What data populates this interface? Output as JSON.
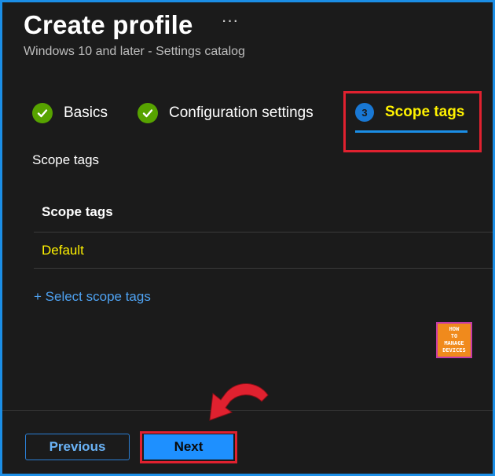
{
  "header": {
    "title": "Create profile",
    "more_icon": "···",
    "subtitle": "Windows 10 and later - Settings catalog"
  },
  "steps": [
    {
      "label": "Basics",
      "state": "complete",
      "icon": "check-icon"
    },
    {
      "label": "Configuration settings",
      "state": "complete",
      "icon": "check-icon"
    },
    {
      "label": "Scope tags",
      "state": "active",
      "number": "3"
    }
  ],
  "section": {
    "label": "Scope tags"
  },
  "table": {
    "header": "Scope tags",
    "rows": [
      "Default"
    ]
  },
  "select_link": "+ Select scope tags",
  "watermark": {
    "lines": [
      "HOW",
      "TO",
      "MANAGE",
      "DEVICES"
    ]
  },
  "footer": {
    "previous_label": "Previous",
    "next_label": "Next"
  },
  "colors": {
    "accent": "#1b8ee6",
    "highlight_text": "#fff200",
    "success": "#57a300",
    "annotation_red": "#e0212f"
  }
}
